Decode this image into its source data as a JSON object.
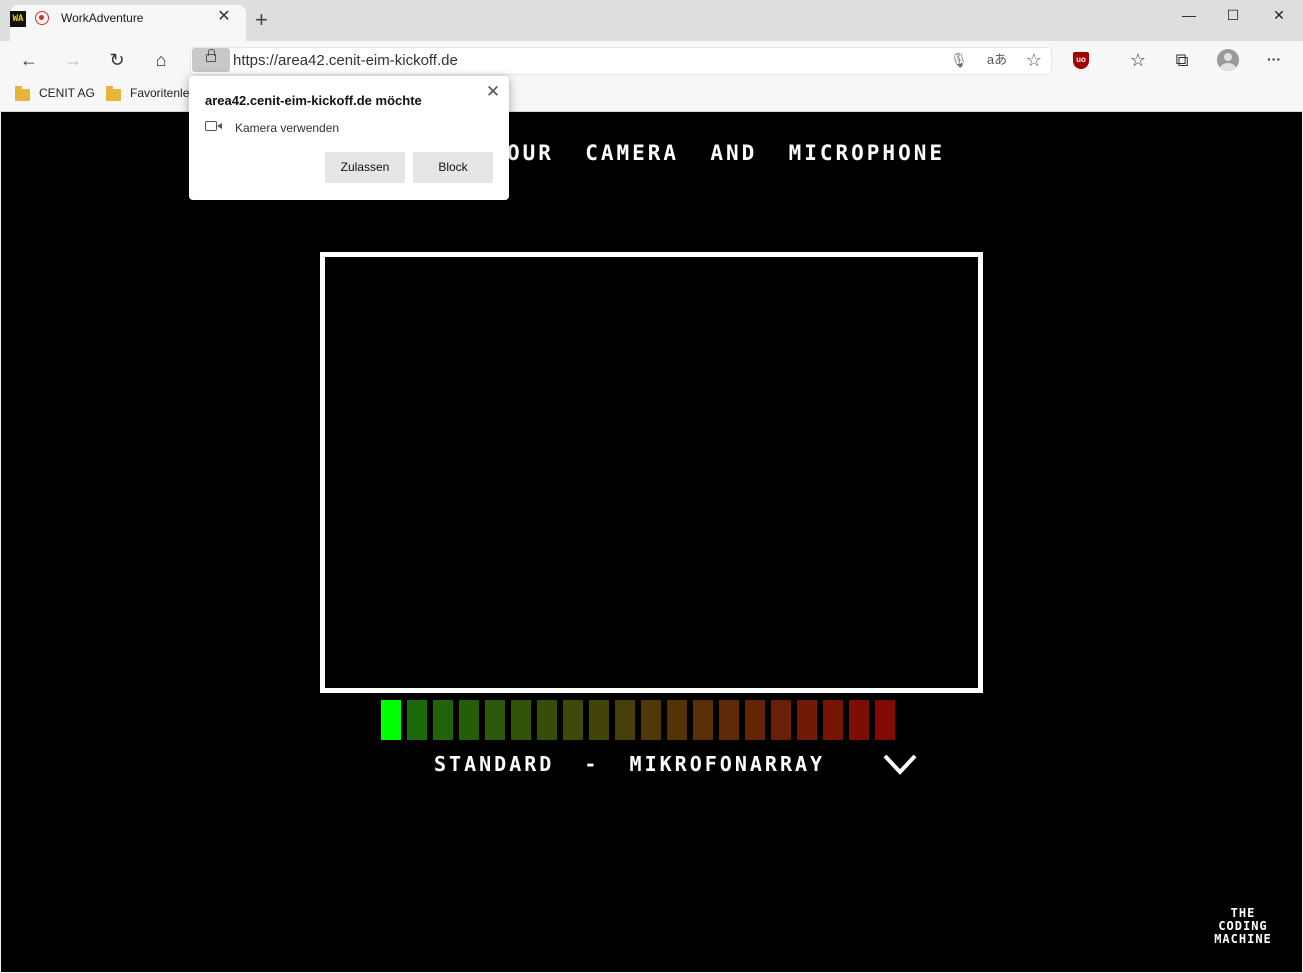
{
  "browser": {
    "tab": {
      "title": "WorkAdventure",
      "close_glyph": "✕",
      "favicon_text": "WA"
    },
    "new_tab_glyph": "+",
    "window_controls": {
      "minimize": "—",
      "maximize": "☐",
      "close": "✕"
    },
    "nav": {
      "back": "←",
      "forward": "→",
      "reload": "↻",
      "home": "⌂"
    },
    "url": "https://area42.cenit-eim-kickoff.de",
    "toolbar_icons": [
      "microphone-icon",
      "read-aloud-icon",
      "add-favorite-icon",
      "ublock-icon",
      "favorites-icon",
      "collections-icon",
      "profile-icon",
      "more-icon"
    ],
    "toolbar_glyphs": {
      "mic": "🎙",
      "read": "aあ",
      "fav_add": "☆",
      "ublock": "uo",
      "favorites": "☆",
      "collections": "⧉",
      "more": "···"
    },
    "bookmarks": [
      {
        "label": "CENIT AG"
      },
      {
        "label": "Favoritenle"
      }
    ]
  },
  "permission_popup": {
    "title": "area42.cenit-eim-kickoff.de möchte",
    "permission": "Kamera verwenden",
    "allow_label": "Zulassen",
    "block_label": "Block",
    "close_glyph": "✕"
  },
  "game": {
    "heading": "OUR  CAMERA  AND  MICROPHONE",
    "mic_device": "STANDARD  -  MIKROFONARRAY",
    "logo_lines": [
      "THE",
      "CODING",
      "MACHINE"
    ],
    "mic_level": {
      "active_bars": 1,
      "total_bars": 20
    },
    "colors": {
      "background": "#000000",
      "frame": "#ffffff",
      "active_bar": "#00ff00"
    }
  }
}
